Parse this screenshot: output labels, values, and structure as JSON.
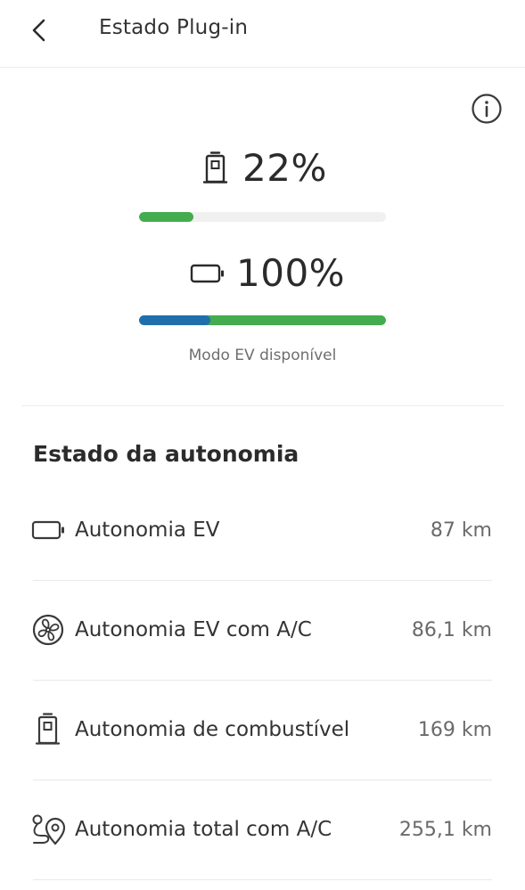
{
  "header": {
    "title": "Estado Plug-in",
    "back_icon": "chevron-left-icon"
  },
  "info_icon": "info-icon",
  "fuel": {
    "icon": "fuel-pump-icon",
    "value_text": "22%",
    "level_fraction": 0.22,
    "color": "#43ac4f"
  },
  "battery": {
    "icon": "battery-icon",
    "value_text": "100%",
    "level_fraction": 1.0,
    "blue_fraction": 0.29,
    "colors": {
      "blue": "#1f6fad",
      "green": "#43ac4f"
    }
  },
  "ev_mode_text": "Modo EV disponível",
  "range": {
    "title": "Estado da autonomia",
    "items": [
      {
        "icon": "battery-icon",
        "label": "Autonomia EV",
        "value": "87 km"
      },
      {
        "icon": "fan-icon",
        "label": "Autonomia EV com A/C",
        "value": "86,1 km"
      },
      {
        "icon": "fuel-pump-icon",
        "label": "Autonomia de combustível",
        "value": "169 km"
      },
      {
        "icon": "route-pin-icon",
        "label": "Autonomia total com A/C",
        "value": "255,1 km"
      }
    ]
  }
}
